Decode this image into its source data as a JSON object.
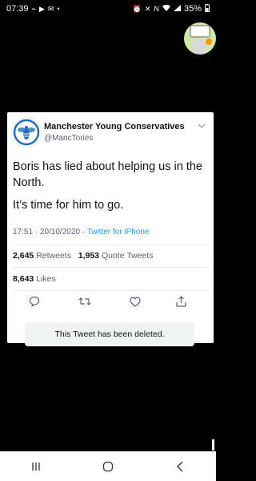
{
  "status_bar": {
    "time": "07:39",
    "left_icons": [
      "usb-icon",
      "youtube-icon",
      "mail-icon",
      "dot-icon"
    ],
    "right_icons": [
      "alarm-icon",
      "mute-icon",
      "nfc-icon",
      "wifi-icon",
      "signal-icon"
    ],
    "battery": "35%"
  },
  "tweet": {
    "author_name": "Manchester Young Conservatives",
    "author_handle": "@MancTories",
    "text_line1": "Boris has lied about helping us in the North.",
    "text_line2": "It’s time for him to go.",
    "time": "17:51 · 20/10/2020 · ",
    "via": "Twitter for iPhone",
    "retweets_count": "2,645",
    "retweets_label": "Retweets",
    "quotes_count": "1,953",
    "quotes_label": "Quote Tweets",
    "likes_count": "8,643",
    "likes_label": "Likes",
    "deleted_notice": "This Tweet has been deleted."
  },
  "colors": {
    "link": "#1d9bf0",
    "secondary_text": "#536471",
    "primary_text": "#0f1419",
    "avatar_blue": "#1f6fbf"
  },
  "nav_bar": {
    "buttons": [
      "recent-apps-icon",
      "home-icon",
      "back-icon"
    ]
  }
}
